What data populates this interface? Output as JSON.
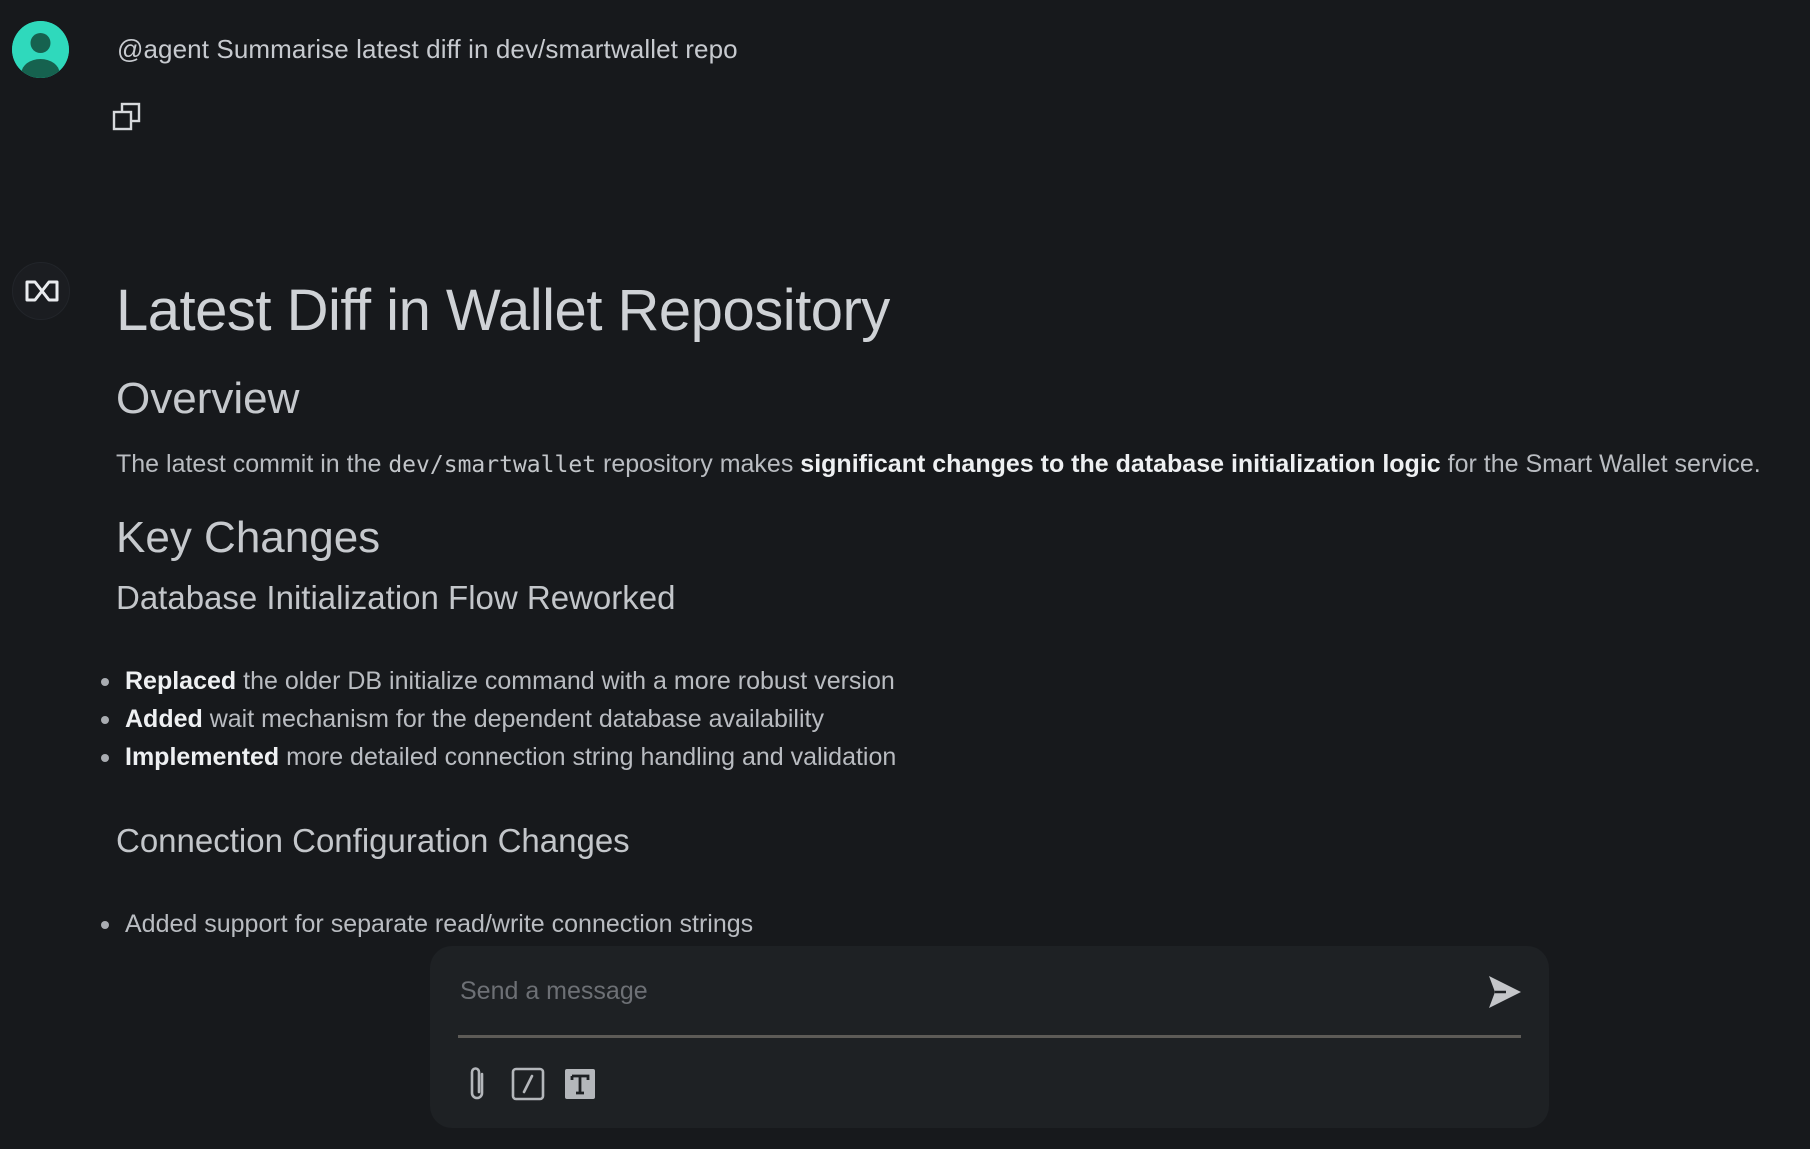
{
  "user_message": {
    "text": "@agent Summarise latest diff in dev/smartwallet repo",
    "avatar_icon": "user-avatar-icon",
    "avatar_color": "#2fd9bc",
    "copy_icon": "copy-icon"
  },
  "assistant_message": {
    "avatar_icon": "agent-logo-icon",
    "title": "Latest Diff in Wallet Repository",
    "overview_heading": "Overview",
    "overview": {
      "prefix": "The latest commit in the ",
      "code": "dev/smartwallet",
      "middle": " repository makes ",
      "bold": "significant changes to the database initialization logic",
      "suffix": " for the Smart Wallet service."
    },
    "key_changes_heading": "Key Changes",
    "section1_heading": "Database Initialization Flow Reworked",
    "section1_items": [
      {
        "bold": "Replaced",
        "text": " the older DB initialize command with a more robust version"
      },
      {
        "bold": "Added",
        "text": " wait mechanism for the dependent database availability"
      },
      {
        "bold": "Implemented",
        "text": " more detailed connection string handling and validation"
      }
    ],
    "section2_heading": "Connection Configuration Changes",
    "section2_items": [
      {
        "text": "Added support for separate read/write connection strings"
      }
    ]
  },
  "composer": {
    "placeholder": "Send a message",
    "value": "",
    "send_icon": "send-icon",
    "tools": [
      "attach-icon",
      "slash-command-icon",
      "text-format-icon"
    ]
  }
}
